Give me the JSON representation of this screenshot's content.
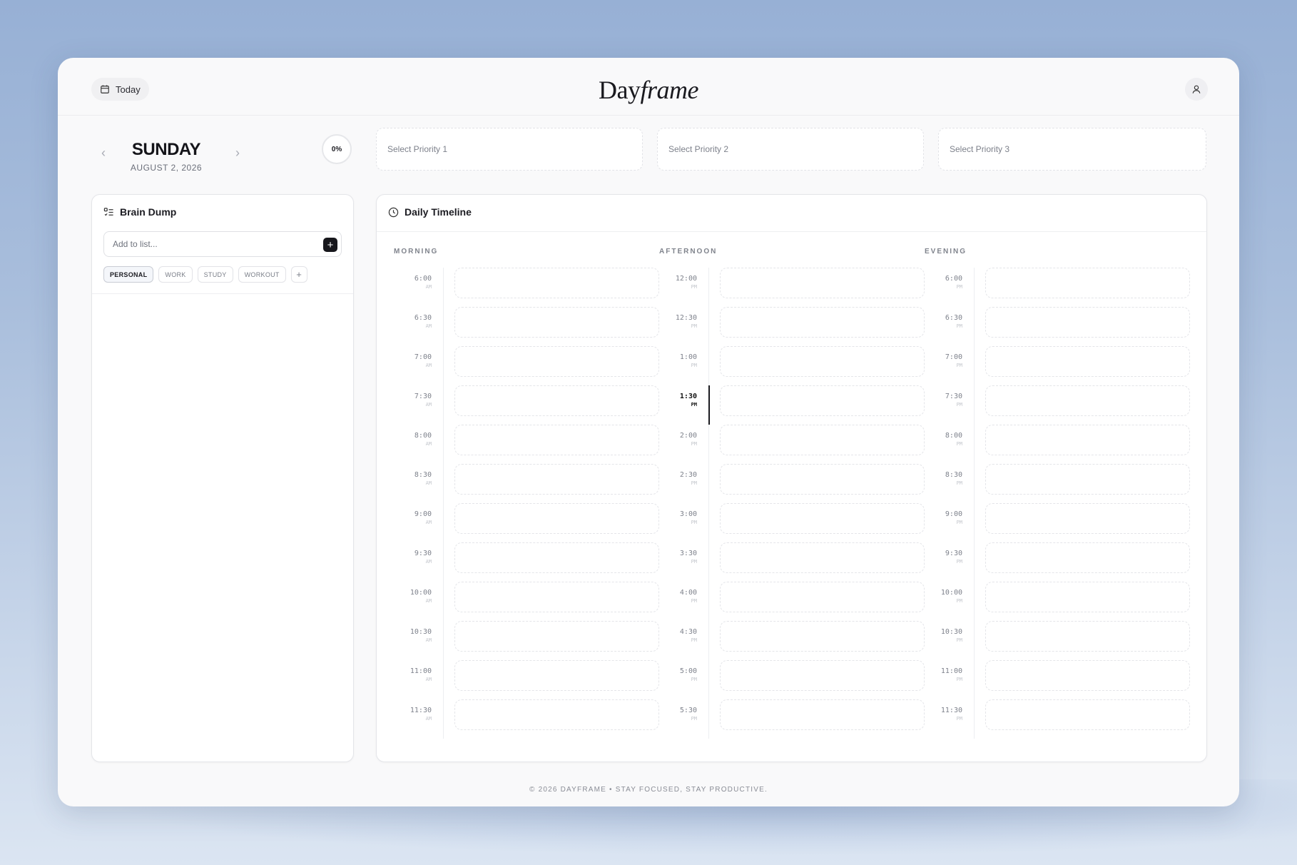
{
  "header": {
    "today_label": "Today",
    "logo_regular": "Day",
    "logo_italic": "frame"
  },
  "day": {
    "name": "SUNDAY",
    "date": "AUGUST 2, 2026",
    "progress": "0%"
  },
  "priorities": [
    "Select Priority 1",
    "Select Priority 2",
    "Select Priority 3"
  ],
  "brain_dump": {
    "title": "Brain Dump",
    "placeholder": "Add to list...",
    "tags": [
      "PERSONAL",
      "WORK",
      "STUDY",
      "WORKOUT"
    ],
    "active_tag": "PERSONAL",
    "add_tag": "+"
  },
  "timeline": {
    "title": "Daily Timeline",
    "current_slot": "1:30 PM",
    "columns": [
      {
        "title": "MORNING",
        "meridiem": "AM",
        "times": [
          "6:00",
          "6:30",
          "7:00",
          "7:30",
          "8:00",
          "8:30",
          "9:00",
          "9:30",
          "10:00",
          "10:30",
          "11:00",
          "11:30"
        ]
      },
      {
        "title": "AFTERNOON",
        "meridiem": "PM",
        "times": [
          "12:00",
          "12:30",
          "1:00",
          "1:30",
          "2:00",
          "2:30",
          "3:00",
          "3:30",
          "4:00",
          "4:30",
          "5:00",
          "5:30"
        ]
      },
      {
        "title": "EVENING",
        "meridiem": "PM",
        "times": [
          "6:00",
          "6:30",
          "7:00",
          "7:30",
          "8:00",
          "8:30",
          "9:00",
          "9:30",
          "10:00",
          "10:30",
          "11:00",
          "11:30"
        ]
      }
    ]
  },
  "footer": "© 2026 DAYFRAME • STAY FOCUSED, STAY PRODUCTIVE.",
  "colors": {
    "accent": "#17171c",
    "background": "#a9bedc",
    "card": "#f9f9fa"
  }
}
